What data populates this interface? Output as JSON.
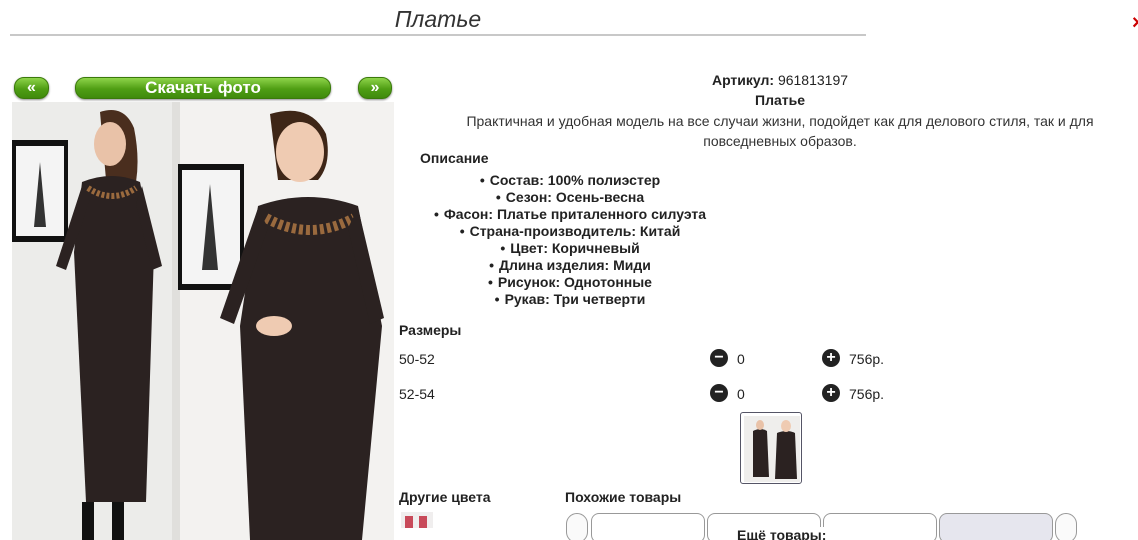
{
  "page": {
    "title": "Платье",
    "close_mark": "×"
  },
  "nav": {
    "prev_label": "«",
    "download_label": "Скачать фото",
    "next_label": "»"
  },
  "product": {
    "article_label": "Артикул:",
    "article_value": "961813197",
    "name": "Платье",
    "description": "Практичная и удобная модель на все случаи жизни, подойдет как для делового стиля, так и для повседневных образов."
  },
  "description_section": {
    "heading": "Описание",
    "features": [
      "Состав: 100% полиэстер",
      "Сезон: Осень-весна",
      "Фасон: Платье приталенного силуэта",
      "Страна-производитель: Китай",
      "Цвет: Коричневый",
      "Длина изделия: Миди",
      "Рисунок: Однотонные",
      "Рукав: Три четверти"
    ]
  },
  "sizes": {
    "heading": "Размеры",
    "minus_symbol": "−",
    "plus_symbol": "+",
    "rows": [
      {
        "size": "50-52",
        "qty": "0",
        "price": "756р."
      },
      {
        "size": "52-54",
        "qty": "0",
        "price": "756р."
      }
    ]
  },
  "other_colors": {
    "heading": "Другие цвета"
  },
  "similar": {
    "heading": "Похожие товары",
    "more_label": "Ещё товары:"
  },
  "colors": {
    "button_green": "#4f9e14",
    "dress_brown": "#2b2221",
    "embroidery": "#9a6a3e"
  },
  "icons": [
    "minus-circle-icon",
    "plus-circle-icon",
    "close-icon"
  ]
}
